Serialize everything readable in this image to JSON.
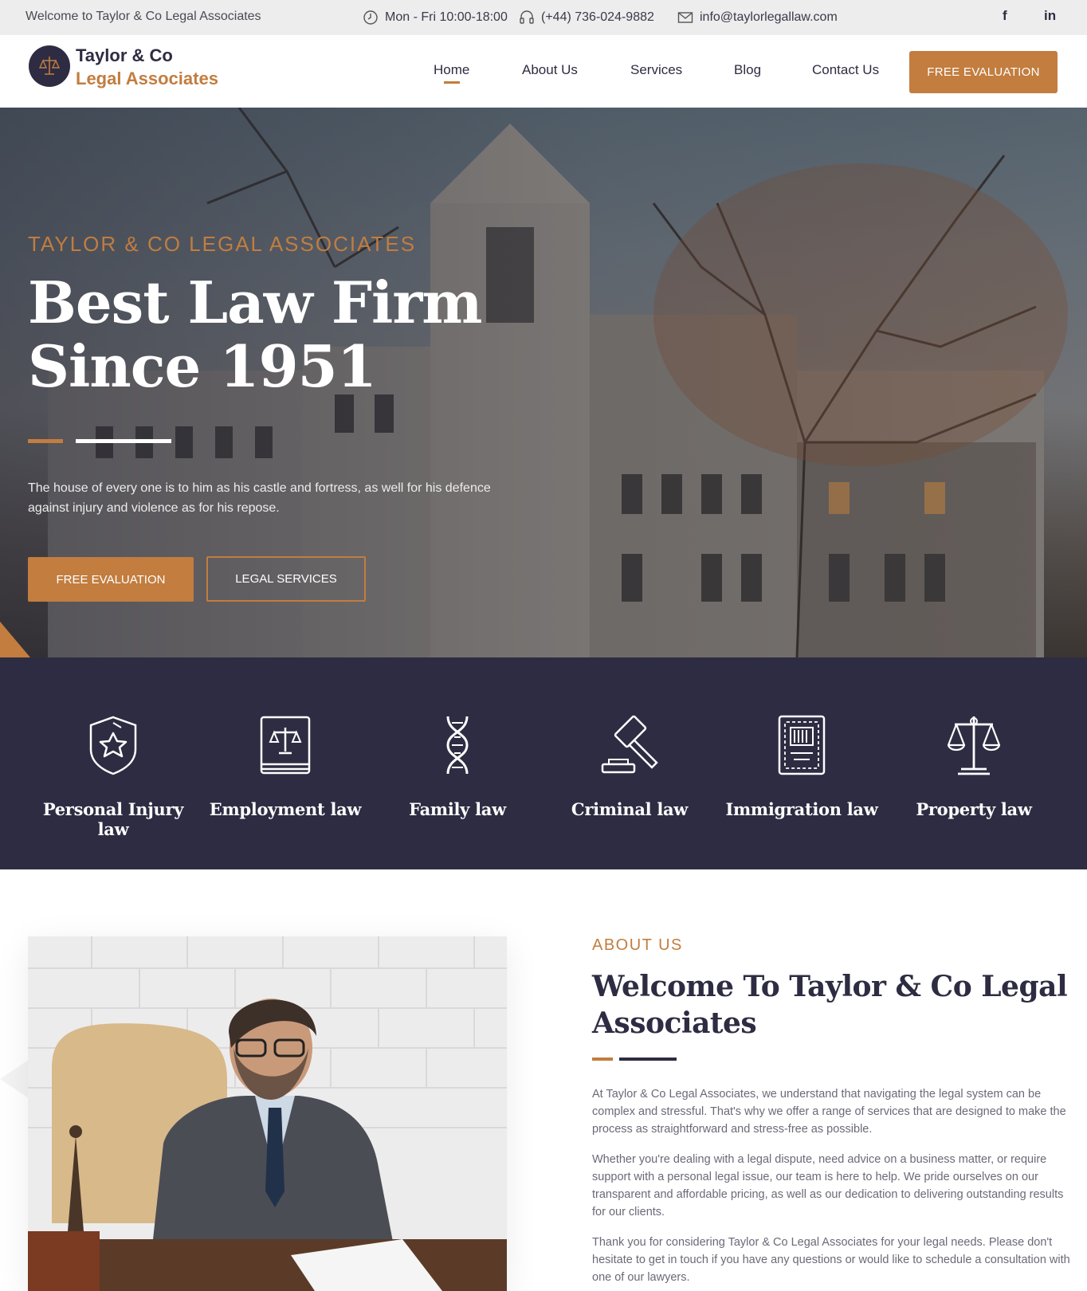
{
  "topbar": {
    "welcome": "Welcome to Taylor & Co Legal Associates",
    "hours": "Mon - Fri 10:00-18:00",
    "phone": "(+44) 736-024-9882",
    "email": "info@taylorlegallaw.com",
    "social": {
      "facebook": "f",
      "linkedin": "in"
    }
  },
  "header": {
    "logo_line1": "Taylor & Co",
    "logo_line2": "Legal Associates",
    "nav": [
      "Home",
      "About Us",
      "Services",
      "Blog",
      "Contact Us"
    ],
    "cta": "FREE EVALUATION"
  },
  "hero": {
    "kicker": "TAYLOR & CO LEGAL ASSOCIATES",
    "title_line1": "Best Law Firm",
    "title_line2": "Since 1951",
    "description": "The house of every one is to him as his castle and fortress, as well for his defence against injury and violence as for his repose.",
    "btn_primary": "FREE EVALUATION",
    "btn_secondary": "LEGAL SERVICES"
  },
  "practice_areas": [
    {
      "label": "Personal Injury law",
      "icon": "shield-star-icon"
    },
    {
      "label": "Employment law",
      "icon": "law-book-icon"
    },
    {
      "label": "Family law",
      "icon": "dna-icon"
    },
    {
      "label": "Criminal law",
      "icon": "gavel-icon"
    },
    {
      "label": "Immigration law",
      "icon": "passport-icon"
    },
    {
      "label": "Property law",
      "icon": "scales-icon"
    }
  ],
  "about": {
    "kicker": "ABOUT US",
    "title": "Welcome To Taylor & Co Legal Associates",
    "p1": "At Taylor & Co Legal Associates, we understand that navigating the legal system can be complex and stressful. That's why we offer a range of services that are designed to make the process as straightforward and stress-free as possible.",
    "p2": "Whether you're dealing with a legal dispute, need advice on a business matter, or require support with a personal legal issue, our team is here to help. We pride ourselves on our transparent and affordable pricing, as well as our dedication to delivering outstanding results for our clients.",
    "p3": "Thank you for considering Taylor & Co Legal Associates for your legal needs. Please don't hesitate to get in touch if you have any questions or would like to schedule a consultation with one of our lawyers."
  },
  "colors": {
    "accent": "#c27d3f",
    "navy": "#2e2c42",
    "topbar": "#ededed"
  }
}
